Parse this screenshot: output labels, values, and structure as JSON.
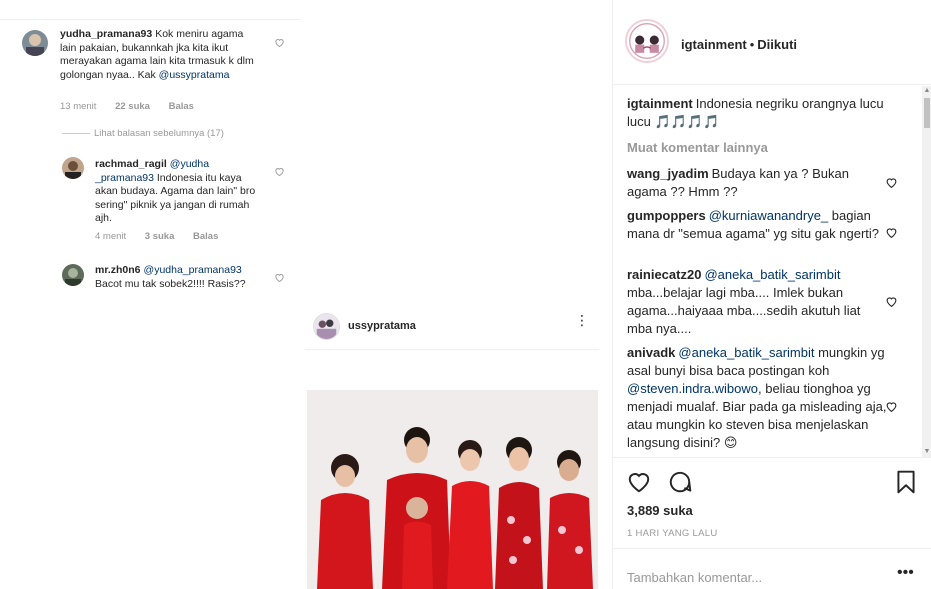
{
  "left": {
    "comments": [
      {
        "username": "yudha_pramana93",
        "text": "Kok meniru agama lain pakaian, bukannkah jka kita ikut merayakan agama lain kita trmasuk k dlm golongan nyaa.. Kak",
        "mention": "@ussypratama",
        "time": "13 menit",
        "likes": "22 suka",
        "reply": "Balas"
      },
      {
        "username": "rachmad_ragil",
        "mention": "@yudha _pramana93",
        "text": "Indonesia itu kaya akan budaya. Agama dan lain\" bro sering\" piknik ya jangan di rumah ajh.",
        "time": "4 menit",
        "likes": "3 suka",
        "reply": "Balas"
      },
      {
        "username": "mr.zh0n6",
        "mention": "@yudha_pramana93",
        "text": "Bacot mu tak sobek2!!!! Rasis??"
      }
    ],
    "view_previous": "Lihat balasan sebelumnya (17)"
  },
  "middle": {
    "username": "ussypratama",
    "more": "⋮"
  },
  "right": {
    "header": {
      "username": "igtainment",
      "separator": "•",
      "follow_status": "Diikuti"
    },
    "caption": {
      "username": "igtainment",
      "text": "Indonesia negriku orangnya lucu lucu 🎵🎵🎵🎵"
    },
    "load_more": "Muat komentar lainnya",
    "comments": [
      {
        "username": "wang_jyadim",
        "mention": "",
        "text": "Budaya kan ya ? Bukan agama ?? Hmm ??"
      },
      {
        "username": "gumpoppers",
        "mention": "@kurniawanandrye_",
        "text": "bagian mana dr \"semua agama\" yg situ gak ngerti?"
      },
      {
        "username": "rainiecatz20",
        "mention": "@aneka_batik_sarimbit",
        "text": "mba...belajar lagi mba.... Imlek bukan agama...haiyaaa mba....sedih akutuh liat mba nya...."
      },
      {
        "username": "anivadk",
        "mention": "@aneka_batik_sarimbit",
        "text": "mungkin yg asal bunyi bisa baca postingan koh",
        "mention2": "@steven.indra.wibowo",
        "text2": ", beliau tionghoa yg menjadi mualaf. Biar pada ga misleading aja, atau mungkin ko steven bisa menjelaskan langsung disini? 😊"
      }
    ],
    "likes": "3,889 suka",
    "time": "1 HARI YANG LALU",
    "add_comment_placeholder": "Tambahkan komentar...",
    "add_more": "•••"
  },
  "icons": {
    "heart": "heart-icon",
    "comment": "comment-bubble-icon",
    "bookmark": "bookmark-icon",
    "more": "more-dots-icon"
  },
  "colors": {
    "mention": "#003569",
    "muted": "#999999",
    "text": "#262626",
    "border": "#efefef"
  }
}
